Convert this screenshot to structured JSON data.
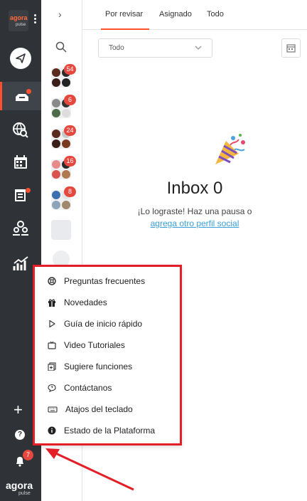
{
  "brand": {
    "name": "agora",
    "sub": "pulse"
  },
  "nav": {
    "items": [
      "publish-icon",
      "inbox-icon",
      "listening-icon",
      "calendar-icon",
      "reports-icon",
      "team-icon",
      "analytics-icon"
    ],
    "notification_count": "7"
  },
  "profiles": [
    {
      "badge": "54"
    },
    {
      "badge": "6"
    },
    {
      "badge": "24"
    },
    {
      "badge": "16"
    },
    {
      "badge": "8"
    }
  ],
  "tabs": [
    {
      "label": "Por revisar",
      "active": true
    },
    {
      "label": "Asignado",
      "active": false
    },
    {
      "label": "Todo",
      "active": false
    }
  ],
  "filter": {
    "value": "Todo"
  },
  "inbox": {
    "title": "Inbox 0",
    "subtitle": "¡Lo lograste! Haz una pausa o",
    "link": "agrega otro perfil social"
  },
  "help_menu": {
    "items": [
      {
        "label": "Preguntas frecuentes",
        "icon": "lifebuoy-icon"
      },
      {
        "label": "Novedades",
        "icon": "gift-icon"
      },
      {
        "label": "Guía de inicio rápido",
        "icon": "play-icon"
      },
      {
        "label": "Video Tutoriales",
        "icon": "tv-icon"
      },
      {
        "label": "Sugiere funciones",
        "icon": "suggest-icon"
      },
      {
        "label": "Contáctanos",
        "icon": "chat-icon"
      },
      {
        "label": "Atajos del teclado",
        "icon": "keyboard-icon"
      },
      {
        "label": "Estado de la Plataforma",
        "icon": "info-icon"
      }
    ]
  },
  "colors": {
    "accent": "#ff4f2e",
    "nav_bg": "#2f3338",
    "link": "#3a9fd6",
    "highlight": "#e41e26"
  }
}
